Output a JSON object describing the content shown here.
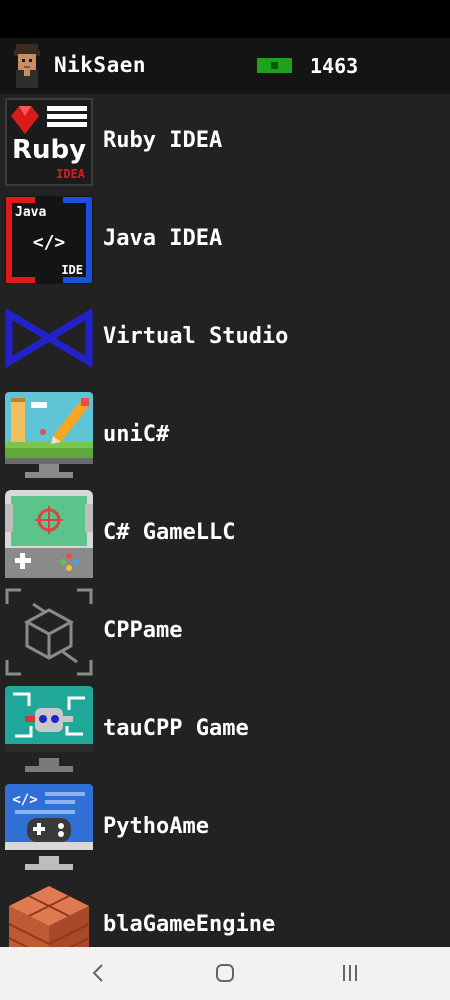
{
  "header": {
    "username": "NikSaen",
    "money": "1463",
    "avatar_icon": "pixel-avatar-icon",
    "money_icon": "banknote-icon"
  },
  "apps": [
    {
      "name": "Ruby IDEA",
      "icon": "ruby-idea-icon",
      "icon_text": [
        "Ruby",
        "IDEA"
      ]
    },
    {
      "name": "Java IDEA",
      "icon": "java-ide-icon",
      "icon_text": [
        "Java",
        "</>",
        "IDE"
      ]
    },
    {
      "name": "Virtual Studio",
      "icon": "bowtie-logo-icon"
    },
    {
      "name": "uniC#",
      "icon": "monitor-pencil-icon"
    },
    {
      "name": "C# GameLLC",
      "icon": "handheld-console-icon"
    },
    {
      "name": "CPPame",
      "icon": "wireframe-cube-icon"
    },
    {
      "name": "tauCPP Game",
      "icon": "monitor-robot-icon"
    },
    {
      "name": "PythoAme",
      "icon": "monitor-gamepad-icon"
    },
    {
      "name": "blaGameEngine",
      "icon": "brick-block-icon"
    }
  ],
  "colors": {
    "background": "#222222",
    "header": "#141414",
    "money": "#1fa01f",
    "navbar": "#f2f2f2"
  },
  "navbar": {
    "back_icon": "back-chevron-icon",
    "home_icon": "home-icon",
    "recents_icon": "recents-icon"
  }
}
